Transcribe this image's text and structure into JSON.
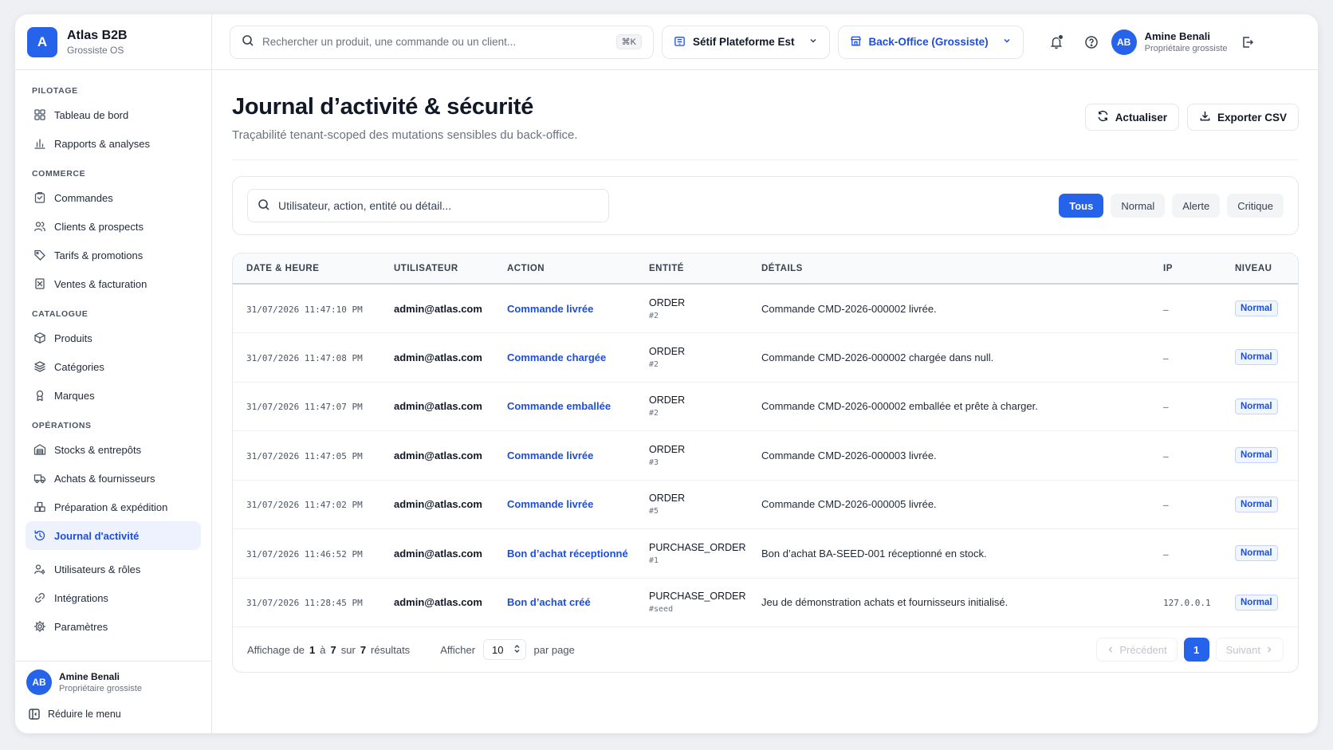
{
  "brand": {
    "logo_letter": "A",
    "name": "Atlas B2B",
    "subtitle": "Grossiste OS"
  },
  "sidebar": {
    "sections": [
      {
        "title": "PILOTAGE",
        "items": [
          {
            "label": "Tableau de bord",
            "icon": "dashboard-icon"
          },
          {
            "label": "Rapports & analyses",
            "icon": "bar-chart-icon"
          }
        ]
      },
      {
        "title": "COMMERCE",
        "items": [
          {
            "label": "Commandes",
            "icon": "orders-icon"
          },
          {
            "label": "Clients & prospects",
            "icon": "users-icon"
          },
          {
            "label": "Tarifs & promotions",
            "icon": "tag-icon"
          },
          {
            "label": "Ventes & facturation",
            "icon": "invoice-icon"
          }
        ]
      },
      {
        "title": "CATALOGUE",
        "items": [
          {
            "label": "Produits",
            "icon": "box-icon"
          },
          {
            "label": "Catégories",
            "icon": "layers-icon"
          },
          {
            "label": "Marques",
            "icon": "brand-icon"
          }
        ]
      },
      {
        "title": "OPÉRATIONS",
        "items": [
          {
            "label": "Stocks & entrepôts",
            "icon": "warehouse-icon"
          },
          {
            "label": "Achats & fournisseurs",
            "icon": "truck-icon"
          },
          {
            "label": "Préparation & expédition",
            "icon": "boxes-icon"
          },
          {
            "label": "Journal d'activité",
            "icon": "history-icon",
            "active": true
          }
        ]
      },
      {
        "title": "",
        "items": [
          {
            "label": "Utilisateurs & rôles",
            "icon": "user-role-icon"
          },
          {
            "label": "Intégrations",
            "icon": "link-icon"
          },
          {
            "label": "Paramètres",
            "icon": "gear-icon"
          }
        ]
      }
    ],
    "user": {
      "initials": "AB",
      "name": "Amine Benali",
      "role": "Propriétaire grossiste"
    },
    "collapse_label": "Réduire le menu"
  },
  "topbar": {
    "search_placeholder": "Rechercher un produit, une commande ou un client...",
    "shortcut": "⌘K",
    "site_select": "Sétif Plateforme Est",
    "mode_select": "Back-Office (Grossiste)",
    "user": {
      "initials": "AB",
      "name": "Amine Benali",
      "role": "Propriétaire grossiste"
    }
  },
  "page": {
    "title": "Journal d’activité & sécurité",
    "subtitle": "Traçabilité tenant-scoped des mutations sensibles du back-office.",
    "refresh_label": "Actualiser",
    "export_label": "Exporter CSV"
  },
  "filters": {
    "search_placeholder": "Utilisateur, action, entité ou détail...",
    "chips": [
      "Tous",
      "Normal",
      "Alerte",
      "Critique"
    ],
    "active_chip": "Tous"
  },
  "table": {
    "headers": [
      "DATE & HEURE",
      "UTILISATEUR",
      "ACTION",
      "ENTITÉ",
      "DÉTAILS",
      "IP",
      "NIVEAU"
    ],
    "rows": [
      {
        "date": "31/07/2026 11:47:10 PM",
        "user": "admin@atlas.com",
        "action": "Commande livrée",
        "entity_type": "ORDER",
        "entity_id": "#2",
        "details": "Commande CMD-2026-000002 livrée.",
        "ip": "—",
        "level": "Normal"
      },
      {
        "date": "31/07/2026 11:47:08 PM",
        "user": "admin@atlas.com",
        "action": "Commande chargée",
        "entity_type": "ORDER",
        "entity_id": "#2",
        "details": "Commande CMD-2026-000002 chargée dans null.",
        "ip": "—",
        "level": "Normal"
      },
      {
        "date": "31/07/2026 11:47:07 PM",
        "user": "admin@atlas.com",
        "action": "Commande emballée",
        "entity_type": "ORDER",
        "entity_id": "#2",
        "details": "Commande CMD-2026-000002 emballée et prête à charger.",
        "ip": "—",
        "level": "Normal"
      },
      {
        "date": "31/07/2026 11:47:05 PM",
        "user": "admin@atlas.com",
        "action": "Commande livrée",
        "entity_type": "ORDER",
        "entity_id": "#3",
        "details": "Commande CMD-2026-000003 livrée.",
        "ip": "—",
        "level": "Normal"
      },
      {
        "date": "31/07/2026 11:47:02 PM",
        "user": "admin@atlas.com",
        "action": "Commande livrée",
        "entity_type": "ORDER",
        "entity_id": "#5",
        "details": "Commande CMD-2026-000005 livrée.",
        "ip": "—",
        "level": "Normal"
      },
      {
        "date": "31/07/2026 11:46:52 PM",
        "user": "admin@atlas.com",
        "action": "Bon d’achat réceptionné",
        "entity_type": "PURCHASE_ORDER",
        "entity_id": "#1",
        "details": "Bon d’achat BA-SEED-001 réceptionné en stock.",
        "ip": "—",
        "level": "Normal"
      },
      {
        "date": "31/07/2026 11:28:45 PM",
        "user": "admin@atlas.com",
        "action": "Bon d’achat créé",
        "entity_type": "PURCHASE_ORDER",
        "entity_id": "#seed",
        "details": "Jeu de démonstration achats et fournisseurs initialisé.",
        "ip": "127.0.0.1",
        "level": "Normal"
      }
    ]
  },
  "pagination": {
    "showing_prefix": "Affichage de",
    "from": "1",
    "to_word": "à",
    "to": "7",
    "of_word": "sur",
    "total": "7",
    "results_word": "résultats",
    "show_label": "Afficher",
    "per_page": "10",
    "per_page_suffix": "par page",
    "prev_label": "Précédent",
    "current_page": "1",
    "next_label": "Suivant"
  },
  "colors": {
    "accent": "#2563eb",
    "accent_text": "#1d4ed8",
    "border": "#e5e7eb"
  }
}
